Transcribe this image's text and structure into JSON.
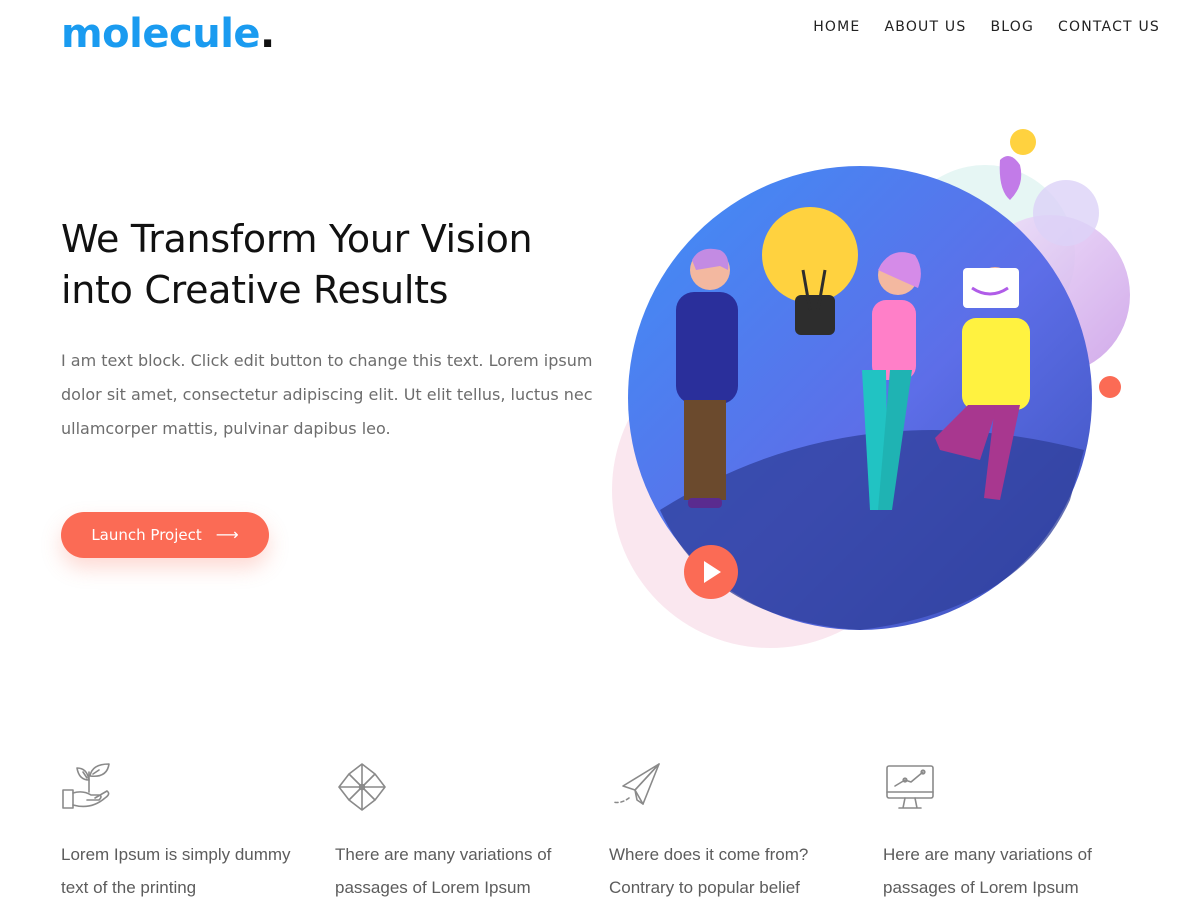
{
  "brand": {
    "name": "molecule",
    "dot": ".",
    "color": "#1a9bf0"
  },
  "nav": {
    "items": [
      {
        "label": "HOME"
      },
      {
        "label": "ABOUT US"
      },
      {
        "label": "BLOG"
      },
      {
        "label": "CONTACT US"
      }
    ]
  },
  "hero": {
    "title_line1": "We Transform Your Vision",
    "title_line2": "into Creative Results",
    "text": "I am text block. Click edit button to change this text. Lorem ipsum dolor sit amet, consectetur adipiscing elit. Ut elit tellus, luctus nec ullamcorper mattis, pulvinar dapibus leo.",
    "button_label": "Launch Project",
    "button_icon": "arrow-right-icon",
    "button_color": "#fb6b55"
  },
  "features": [
    {
      "icon": "plant-hand-icon",
      "line1": "Lorem Ipsum is simply dummy",
      "line2": "text of the printing"
    },
    {
      "icon": "pinwheel-icon",
      "line1": "There are many variations of",
      "line2": "passages of Lorem Ipsum"
    },
    {
      "icon": "paper-plane-icon",
      "line1": "Where does it come from?",
      "line2": "Contrary to popular belief"
    },
    {
      "icon": "monitor-chart-icon",
      "line1": "Here are many variations of",
      "line2": "passages of Lorem Ipsum"
    }
  ]
}
